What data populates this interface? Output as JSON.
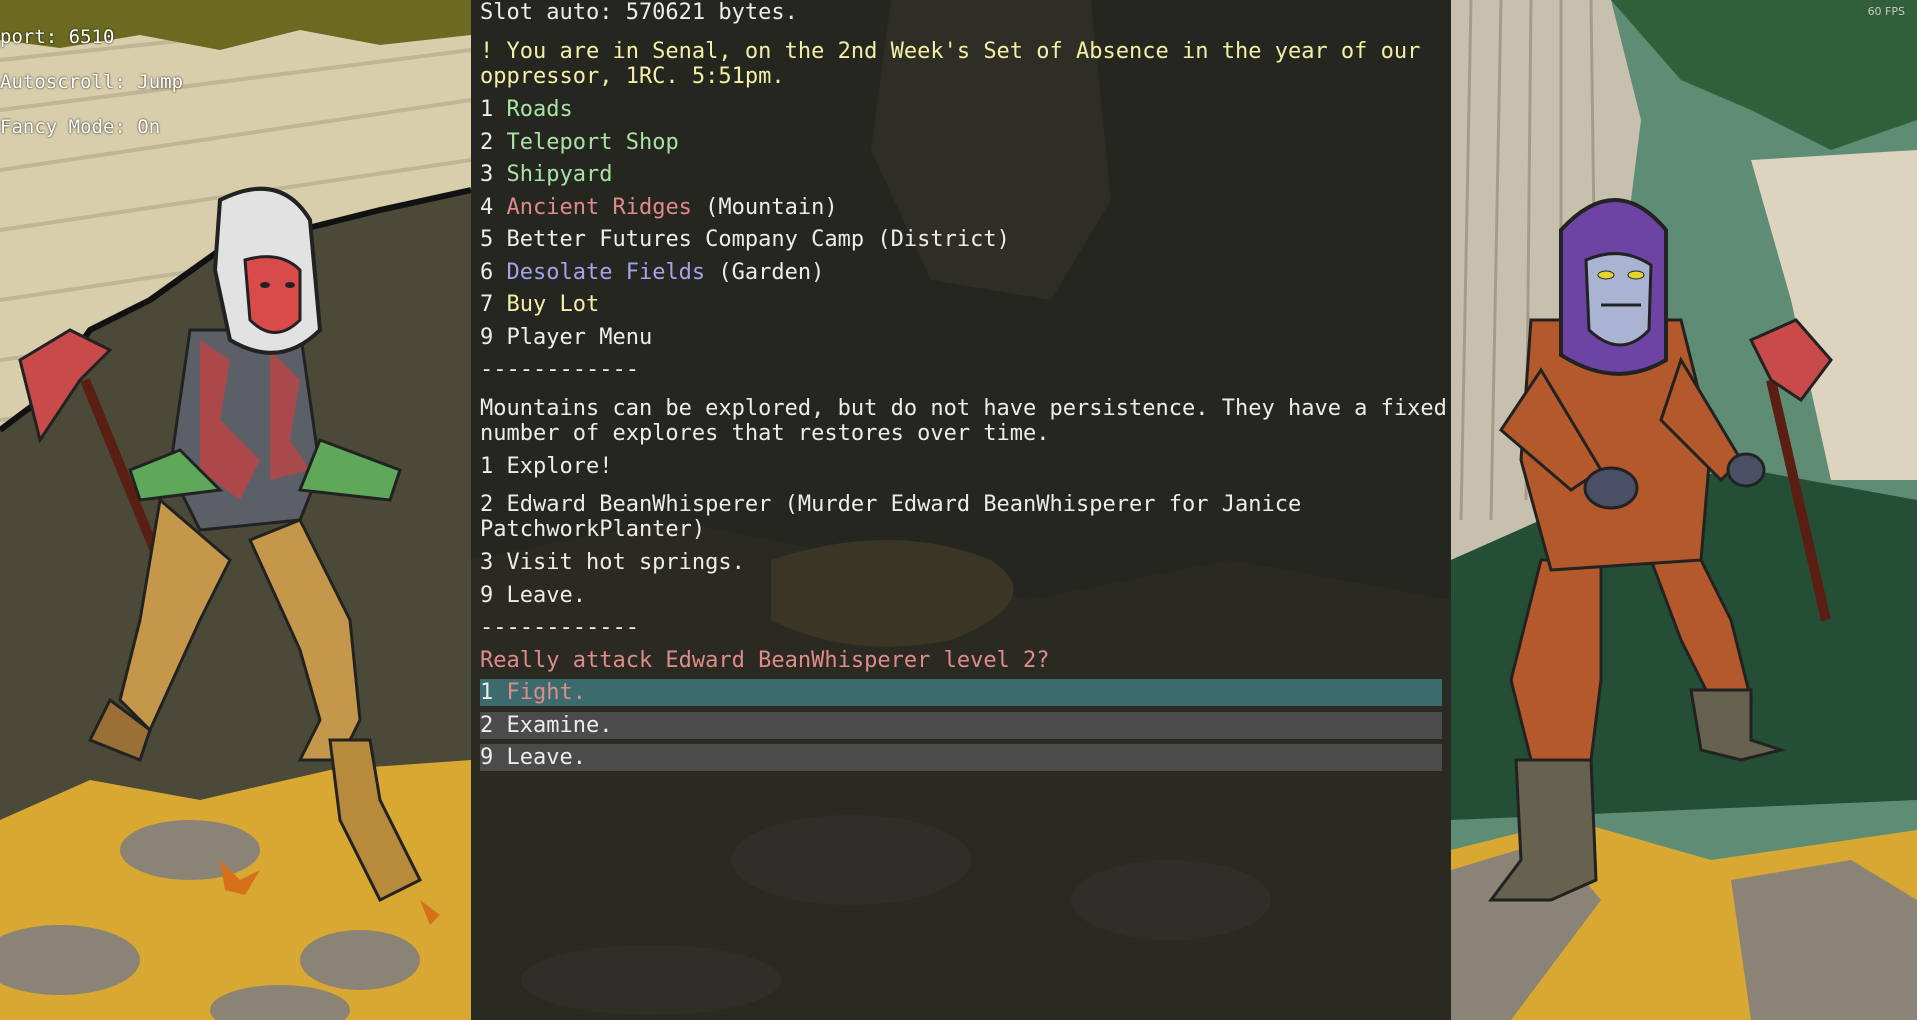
{
  "hud": {
    "port": "port: 6510",
    "autoscroll": "Autoscroll: Jump",
    "fancy_mode": "Fancy Mode: On",
    "fps": "60 FPS"
  },
  "console": {
    "slot_line": "Slot auto: 570621 bytes.",
    "location_line_1": "! You are in Senal, on the 2nd Week's Set of Absence in the year of our",
    "location_line_2": "oppressor, 1RC. 5:51pm.",
    "nav": [
      {
        "num": "1 ",
        "label": "Roads",
        "suffix": ""
      },
      {
        "num": "2 ",
        "label": "Teleport Shop",
        "suffix": ""
      },
      {
        "num": "3 ",
        "label": "Shipyard",
        "suffix": ""
      },
      {
        "num": "4 ",
        "label": "Ancient Ridges",
        "suffix": " (Mountain)"
      },
      {
        "num": "5 ",
        "label": "Better Futures Company Camp (District)",
        "suffix": ""
      },
      {
        "num": "6 ",
        "label": "Desolate Fields",
        "suffix": " (Garden)"
      },
      {
        "num": "7 ",
        "label": "Buy Lot",
        "suffix": ""
      },
      {
        "num": "9 ",
        "label": "Player Menu",
        "suffix": ""
      }
    ],
    "separator_1": "------------",
    "description_1": "Mountains can be explored, but do not have persistence. They have a fixed",
    "description_2": "number of explores that restores over time.",
    "area_options": [
      {
        "text": "1 Explore!"
      },
      {
        "text": "2 Edward BeanWhisperer (Murder Edward BeanWhisperer for Janice"
      },
      {
        "text": "PatchworkPlanter)"
      },
      {
        "text": "3 Visit hot springs."
      },
      {
        "text": "9 Leave."
      }
    ],
    "separator_2": "------------",
    "prompt": "Really attack Edward BeanWhisperer level 2?",
    "choices": [
      {
        "num": "1 ",
        "label": "Fight.",
        "selected": true
      },
      {
        "num": "2 ",
        "label": "Examine.",
        "selected": false
      },
      {
        "num": "9 ",
        "label": "Leave.",
        "selected": false
      }
    ]
  },
  "colors": {
    "yellow_text": "#f3efa6",
    "green_link": "#a9e3a2",
    "red_link": "#e08b8b",
    "blue_link": "#a3a3ec",
    "selected_bg": "#3b6b6d",
    "unselected_bg": "#4b4b4b"
  }
}
